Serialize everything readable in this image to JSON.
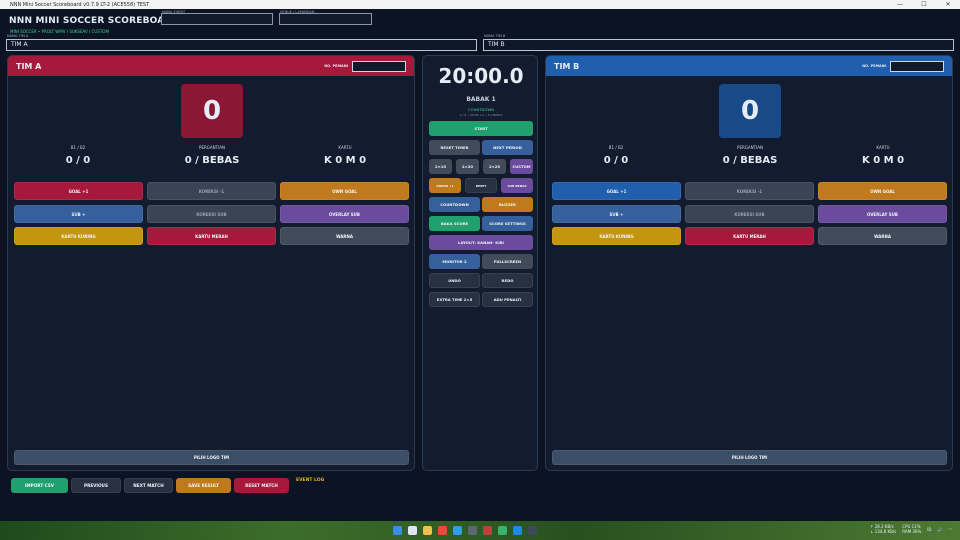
{
  "window": {
    "title": "NNN Mini Soccer Scoreboard v0.7.9 LT-2 (ACE558) TEST"
  },
  "header": {
    "app_title": "NNN MINI SOCCER SCOREBOARD",
    "subtitle": "MINI SOCCER • PROLT WMV / SUKSEAV / CUSTOM",
    "field1_label": "NAMA EVENT",
    "field2_label": "VENUE / LAPANGAN",
    "team_a_label": "NAMA TIM A",
    "team_b_label": "NAMA TIM B",
    "team_a_value": "TIM A",
    "team_b_value": "TIM B"
  },
  "team_a": {
    "name": "TIM A",
    "no_pemain_label": "NO. PEMAIN",
    "score": "0",
    "stat_b1b2_label": "B1 / B2",
    "stat_b1b2": "0 / 0",
    "stat_pergantian_label": "PERGANTIAN",
    "stat_pergantian": "0 / BEBAS",
    "stat_kartu_label": "KARTU",
    "stat_kartu": "K 0   M 0",
    "btn_goal": "GOAL +1",
    "btn_koreksi": "KOREKSI -1",
    "btn_own_goal": "OWN GOAL",
    "btn_sub": "SUB +",
    "btn_koreksi_sub": "KOREKSI SUB",
    "btn_overlay_sub": "OVERLAY SUB",
    "btn_kartu_kuning": "KARTU KUNING",
    "btn_kartu_merah": "KARTU MERAH",
    "btn_warna": "WARNA",
    "btn_logo": "PILIH LOGO TIM"
  },
  "team_b": {
    "name": "TIM B",
    "no_pemain_label": "NO. PEMAIN",
    "score": "0",
    "stat_b1b2_label": "B1 / B2",
    "stat_b1b2": "0 / 0",
    "stat_pergantian_label": "PERGANTIAN",
    "stat_pergantian": "0 / BEBAS",
    "stat_kartu_label": "KARTU",
    "stat_kartu": "K 0   M 0",
    "btn_goal": "GOAL +1",
    "btn_koreksi": "KOREKSI -1",
    "btn_own_goal": "OWN GOAL",
    "btn_sub": "SUB +",
    "btn_koreksi_sub": "KOREKSI SUB",
    "btn_overlay_sub": "OVERLAY SUB",
    "btn_kartu_kuning": "KARTU KUNING",
    "btn_kartu_merah": "KARTU MERAH",
    "btn_warna": "WARNA",
    "btn_logo": "PILIH LOGO TIM"
  },
  "center": {
    "timer": "20:00.0",
    "period": "BABAK 1",
    "mode": "COUNTDOWN",
    "info": "1 / 6 • 40:00 +1 • 5.0 BMbrt",
    "start": "START",
    "reset_timer": "RESET TIMER",
    "next_period": "NEXT PERIOD",
    "p1": "2×15",
    "p2": "2×20",
    "p3": "2×25",
    "custom": "CUSTOM",
    "added": "ADDED +1",
    "reset": "RESET",
    "sub_bebas": "SUB BEBAS",
    "countdown": "COUNTDOWN",
    "buzzer": "BUZZER",
    "baka_score": "BAKA SCORE",
    "score_settings": "SCORE SETTINGS",
    "layout": "LAYOUT: KANAN- KIRI",
    "monitor2": "MONITOR 2",
    "fullscreen": "FULLSCREEN",
    "undo": "UNDO",
    "redo": "REDO",
    "extra_time": "EXTRA TIME 2×5",
    "adu_penalti": "ADU PENALTI"
  },
  "footer": {
    "import_csv": "IMPORT CSV",
    "previous": "PREVIOUS",
    "next_match": "NEXT MATCH",
    "save_result": "SAVE RESULT",
    "reset_match": "RESET MATCH",
    "event_log": "EVENT LOG"
  },
  "taskbar": {
    "net_up": "↑ 28.2 KB/s",
    "net_down": "↓ 134.8 KB/s",
    "cpu": "CPU 11%",
    "ram": "RAM 36%",
    "lang": "ID"
  },
  "colors": {
    "team_a": "#a6193b",
    "team_b": "#1f5fae",
    "accent_green": "#20a06d"
  }
}
